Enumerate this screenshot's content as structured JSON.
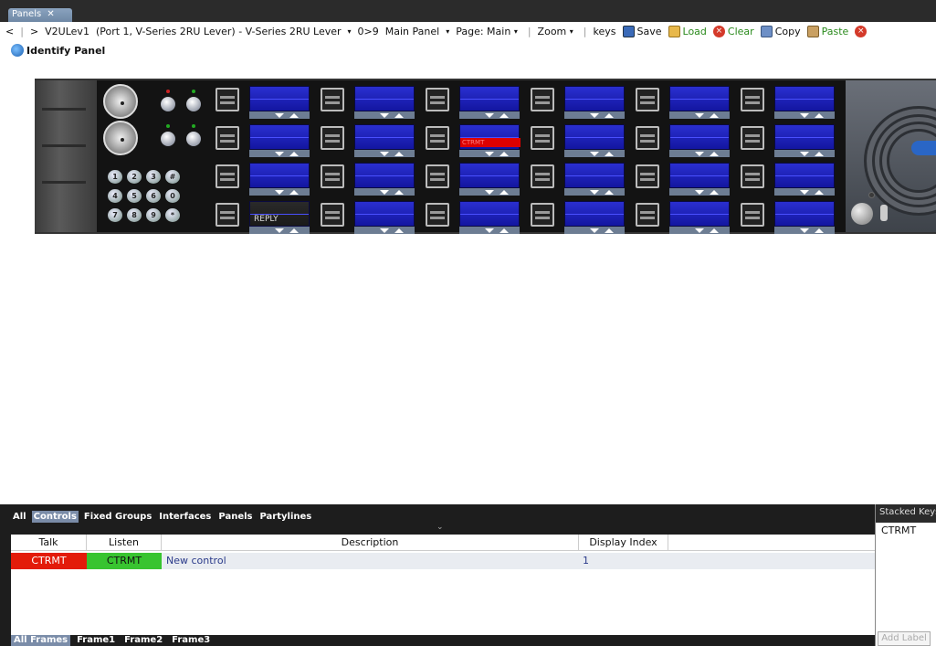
{
  "tabs": {
    "panels_label": "Panels",
    "close_glyph": "✕"
  },
  "toolbar": {
    "nav_back": "<",
    "sep": "|",
    "nav_forward": ">",
    "panel_name": "V2ULev1",
    "panel_desc": "(Port 1, V-Series 2RU Lever) - V-Series 2RU Lever",
    "dropdown_caret": "▾",
    "panel_index": "0>9",
    "main_panel": "Main Panel",
    "page_label": "Page: Main",
    "zoom_label": "Zoom",
    "keys_label": "keys",
    "save_label": "Save",
    "load_label": "Load",
    "clear_label": "Clear",
    "copy_label": "Copy",
    "paste_label": "Paste",
    "clear_glyph": "×"
  },
  "toolbar2": {
    "identify_label": "Identify Panel"
  },
  "panel": {
    "highlight_text": "CTRMT",
    "reply_text": "REPLY",
    "keypad": [
      "1",
      "2",
      "3",
      "#",
      "4",
      "5",
      "6",
      "0",
      "7",
      "8",
      "9",
      "*"
    ]
  },
  "bottom": {
    "filter_tabs": [
      "All",
      "Controls",
      "Fixed Groups",
      "Interfaces",
      "Panels",
      "Partylines"
    ],
    "chevron_glyph": "⌄",
    "columns": {
      "talk": "Talk",
      "listen": "Listen",
      "description": "Description",
      "display_index": "Display Index"
    },
    "rows": [
      {
        "talk": "CTRMT",
        "listen": "CTRMT",
        "description": "New control",
        "display_index": "1"
      }
    ],
    "frame_tabs": [
      "All Frames",
      "Frame1",
      "Frame2",
      "Frame3"
    ]
  },
  "stacked": {
    "title": "Stacked Keys",
    "item": "CTRMT",
    "add_label": "Add Label"
  },
  "colors": {
    "talk": "#e31b0a",
    "listen": "#38c430",
    "display_blue": "#1316a0",
    "tab_active": "#7a8ca8"
  }
}
